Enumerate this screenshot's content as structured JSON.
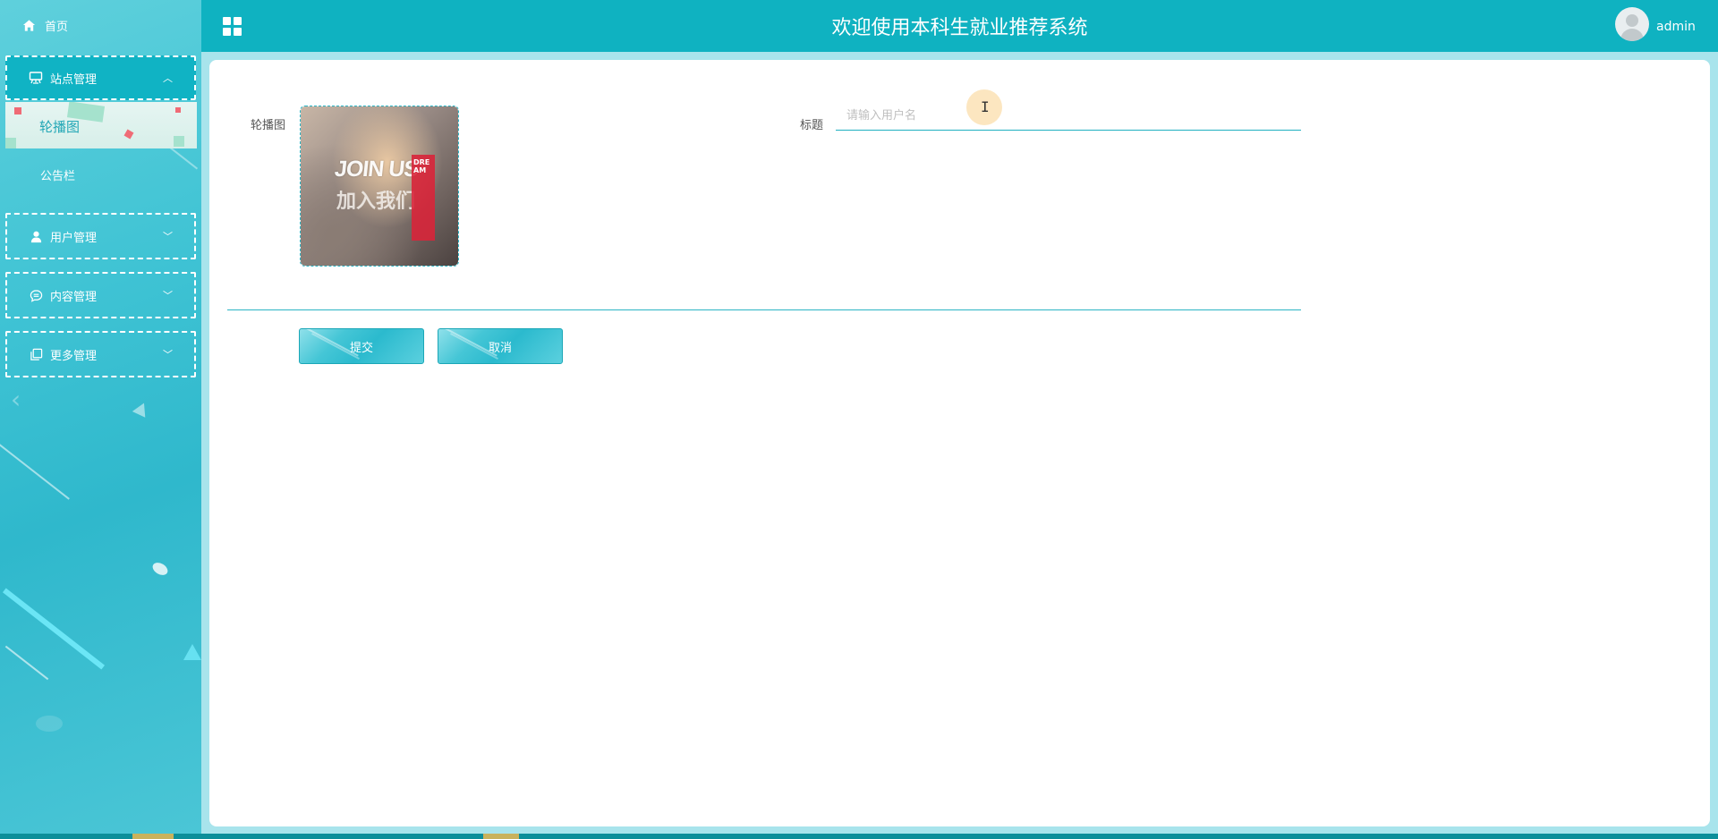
{
  "header": {
    "title": "欢迎使用本科生就业推荐系统",
    "user_name": "admin",
    "accent_color": "#0fb2c1"
  },
  "sidebar": {
    "home_label": "首页",
    "groups": [
      {
        "label": "站点管理",
        "icon": "monitor-icon",
        "expanded": true,
        "items": [
          {
            "label": "轮播图",
            "active": true
          },
          {
            "label": "公告栏",
            "active": false
          }
        ]
      },
      {
        "label": "用户管理",
        "icon": "user-icon",
        "expanded": false
      },
      {
        "label": "内容管理",
        "icon": "chat-icon",
        "expanded": false
      },
      {
        "label": "更多管理",
        "icon": "copy-icon",
        "expanded": false
      }
    ]
  },
  "form": {
    "carousel_label": "轮播图",
    "image_text": {
      "en": "JOIN US",
      "cn": "加入我们",
      "tag": "DREAM"
    },
    "title_label": "标题",
    "title_placeholder": "请输入用户名",
    "title_value": ""
  },
  "actions": {
    "submit_label": "提交",
    "cancel_label": "取消"
  }
}
